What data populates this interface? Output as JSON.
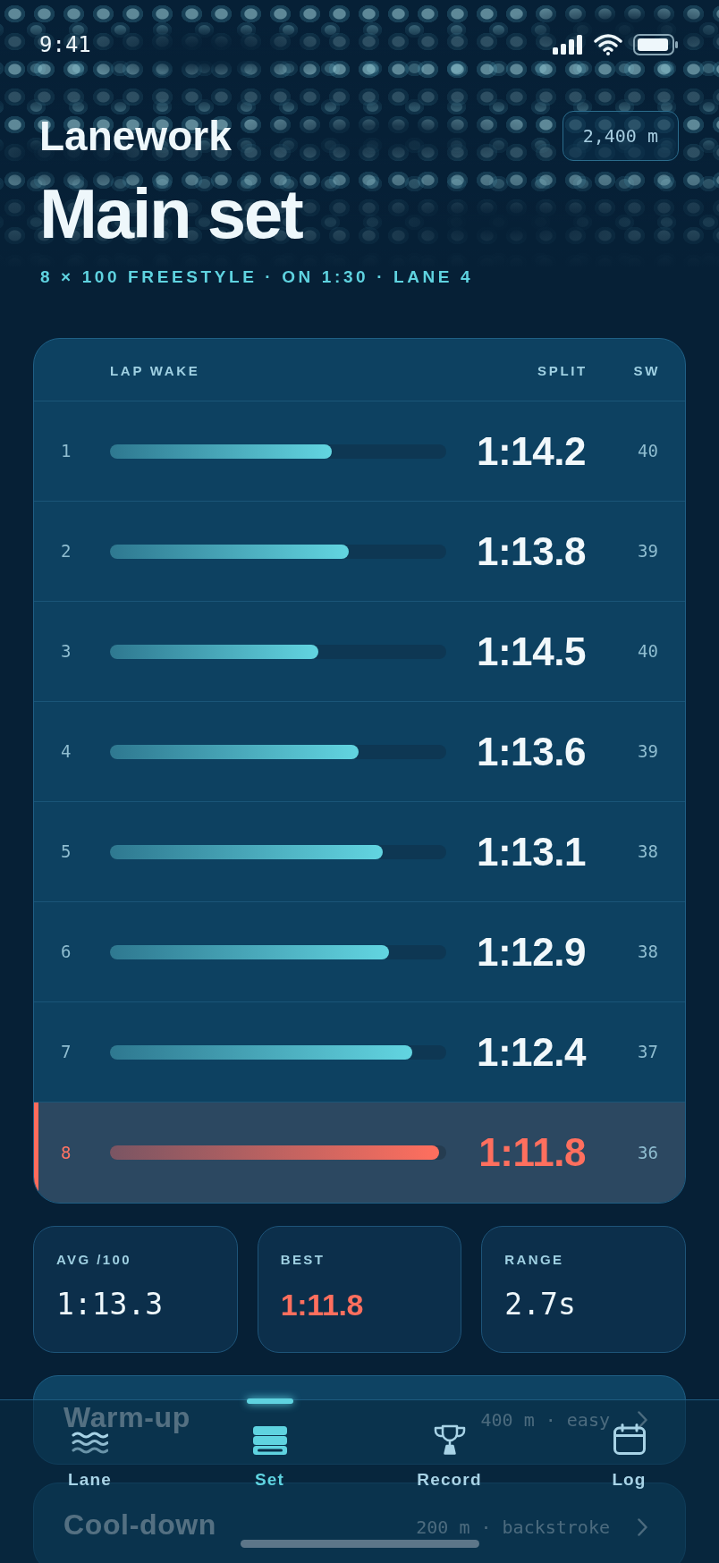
{
  "status_bar": {
    "time": "9:41"
  },
  "header": {
    "eyebrow": "Lanework",
    "distance": "2,400 m",
    "title": "Main set",
    "subtitle": "8 × 100 FREESTYLE · ON 1:30 · LANE 4"
  },
  "laps_table": {
    "columns": [
      "LAP WAKE",
      "SPLIT",
      "SW"
    ],
    "rows": [
      {
        "lap": "1",
        "level": 0.66,
        "split": "1:14.2",
        "strokes": "40",
        "selected": false
      },
      {
        "lap": "2",
        "level": 0.71,
        "split": "1:13.8",
        "strokes": "39",
        "selected": false
      },
      {
        "lap": "3",
        "level": 0.62,
        "split": "1:14.5",
        "strokes": "40",
        "selected": false
      },
      {
        "lap": "4",
        "level": 0.74,
        "split": "1:13.6",
        "strokes": "39",
        "selected": false
      },
      {
        "lap": "5",
        "level": 0.81,
        "split": "1:13.1",
        "strokes": "38",
        "selected": false
      },
      {
        "lap": "6",
        "level": 0.83,
        "split": "1:12.9",
        "strokes": "38",
        "selected": false
      },
      {
        "lap": "7",
        "level": 0.9,
        "split": "1:12.4",
        "strokes": "37",
        "selected": false
      },
      {
        "lap": "8",
        "level": 0.98,
        "split": "1:11.8",
        "strokes": "36",
        "selected": true
      }
    ]
  },
  "stats": [
    {
      "label": "AVG /100",
      "value": "1:13.3",
      "kind": "plain"
    },
    {
      "label": "BEST",
      "value": "1:11.8",
      "kind": "accent"
    },
    {
      "label": "RANGE",
      "value": "2.7s",
      "kind": "plain"
    }
  ],
  "sets": [
    {
      "name": "Warm-up",
      "detail": "400 m · easy"
    },
    {
      "name": "Cool-down",
      "detail": "200 m · backstroke"
    }
  ],
  "tab_bar": [
    {
      "label": "Lane",
      "selected": false
    },
    {
      "label": "Set",
      "selected": true
    },
    {
      "label": "Record",
      "selected": false
    },
    {
      "label": "Log",
      "selected": false
    }
  ]
}
